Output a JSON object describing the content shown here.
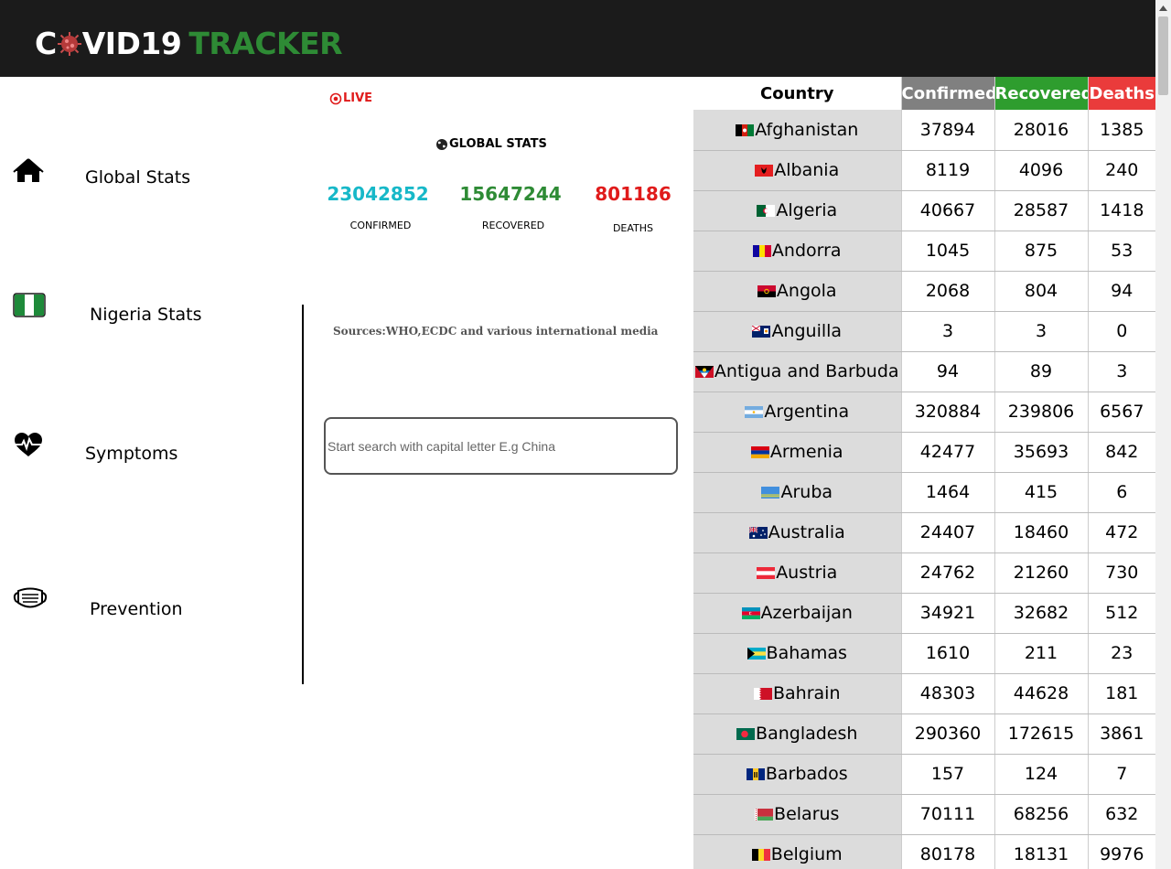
{
  "header": {
    "logo_prefix": "C",
    "logo_suffix": "VID19",
    "logo_accent": "TRACKER",
    "brand_green": "#2e8b35"
  },
  "sidebar": {
    "items": [
      {
        "label": "Global Stats",
        "icon": "home-icon"
      },
      {
        "label": "Nigeria Stats",
        "icon": "nigeria-flag-icon"
      },
      {
        "label": "Symptoms",
        "icon": "heartbeat-icon"
      },
      {
        "label": "Prevention",
        "icon": "mask-icon"
      }
    ]
  },
  "main": {
    "live_label": "LIVE",
    "global_title": "GLOBAL STATS",
    "stats": {
      "confirmed": {
        "value": "23042852",
        "label": "CONFIRMED",
        "color": "#17b8c8"
      },
      "recovered": {
        "value": "15647244",
        "label": "RECOVERED",
        "color": "#2e8b35"
      },
      "deaths": {
        "value": "801186",
        "label": "DEATHS",
        "color": "#e01b1b"
      }
    },
    "sources": "Sources:WHO,ECDC and various international media",
    "search_placeholder": "Start search with capital letter E.g China"
  },
  "table": {
    "headers": {
      "country": "Country",
      "confirmed": "Confirmed",
      "recovered": "Recovered",
      "deaths": "Deaths"
    },
    "header_colors": {
      "confirmed": "#808080",
      "recovered": "#2e9d2e",
      "deaths": "#ea3b3b"
    },
    "rows": [
      {
        "country": "Afghanistan",
        "flag": "flag-afghanistan",
        "confirmed": "37894",
        "recovered": "28016",
        "deaths": "1385"
      },
      {
        "country": "Albania",
        "flag": "flag-albania",
        "confirmed": "8119",
        "recovered": "4096",
        "deaths": "240"
      },
      {
        "country": "Algeria",
        "flag": "flag-algeria",
        "confirmed": "40667",
        "recovered": "28587",
        "deaths": "1418"
      },
      {
        "country": "Andorra",
        "flag": "flag-andorra",
        "confirmed": "1045",
        "recovered": "875",
        "deaths": "53"
      },
      {
        "country": "Angola",
        "flag": "flag-angola",
        "confirmed": "2068",
        "recovered": "804",
        "deaths": "94"
      },
      {
        "country": "Anguilla",
        "flag": "flag-anguilla",
        "confirmed": "3",
        "recovered": "3",
        "deaths": "0"
      },
      {
        "country": "Antigua and Barbuda",
        "flag": "flag-antigua",
        "confirmed": "94",
        "recovered": "89",
        "deaths": "3"
      },
      {
        "country": "Argentina",
        "flag": "flag-argentina",
        "confirmed": "320884",
        "recovered": "239806",
        "deaths": "6567"
      },
      {
        "country": "Armenia",
        "flag": "flag-armenia",
        "confirmed": "42477",
        "recovered": "35693",
        "deaths": "842"
      },
      {
        "country": "Aruba",
        "flag": "flag-aruba",
        "confirmed": "1464",
        "recovered": "415",
        "deaths": "6"
      },
      {
        "country": "Australia",
        "flag": "flag-australia",
        "confirmed": "24407",
        "recovered": "18460",
        "deaths": "472"
      },
      {
        "country": "Austria",
        "flag": "flag-austria",
        "confirmed": "24762",
        "recovered": "21260",
        "deaths": "730"
      },
      {
        "country": "Azerbaijan",
        "flag": "flag-azerbaijan",
        "confirmed": "34921",
        "recovered": "32682",
        "deaths": "512"
      },
      {
        "country": "Bahamas",
        "flag": "flag-bahamas",
        "confirmed": "1610",
        "recovered": "211",
        "deaths": "23"
      },
      {
        "country": "Bahrain",
        "flag": "flag-bahrain",
        "confirmed": "48303",
        "recovered": "44628",
        "deaths": "181"
      },
      {
        "country": "Bangladesh",
        "flag": "flag-bangladesh",
        "confirmed": "290360",
        "recovered": "172615",
        "deaths": "3861"
      },
      {
        "country": "Barbados",
        "flag": "flag-barbados",
        "confirmed": "157",
        "recovered": "124",
        "deaths": "7"
      },
      {
        "country": "Belarus",
        "flag": "flag-belarus",
        "confirmed": "70111",
        "recovered": "68256",
        "deaths": "632"
      },
      {
        "country": "Belgium",
        "flag": "flag-belgium",
        "confirmed": "80178",
        "recovered": "18131",
        "deaths": "9976"
      }
    ]
  }
}
